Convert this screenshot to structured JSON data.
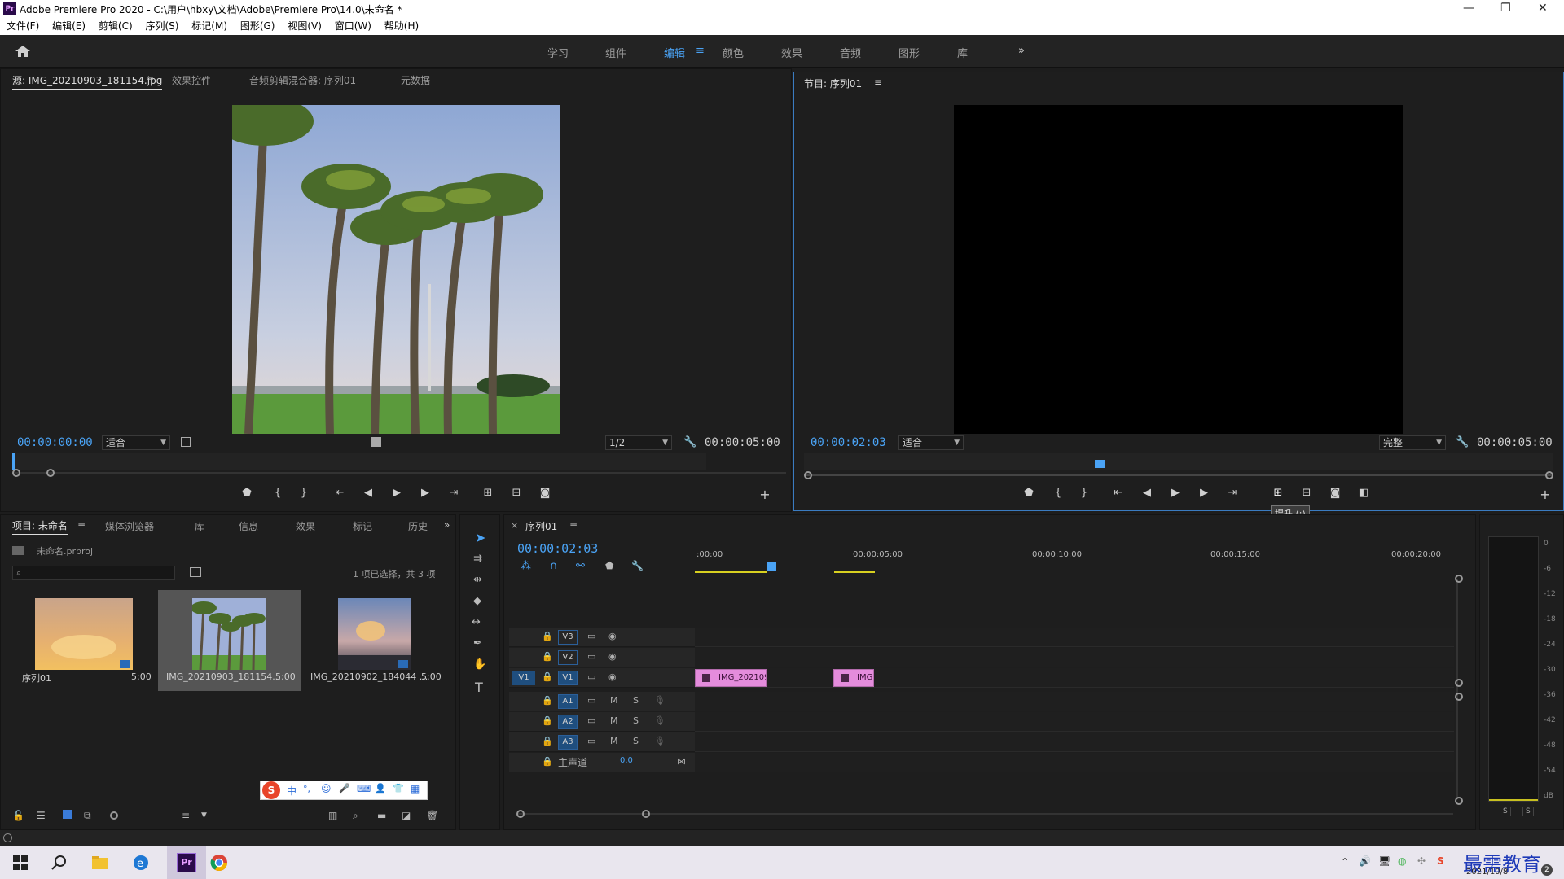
{
  "titlebar": {
    "app_icon": "Pr",
    "title": "Adobe Premiere Pro 2020 - C:\\用户\\hbxy\\文档\\Adobe\\Premiere Pro\\14.0\\未命名 *",
    "minimize": "—",
    "restore": "❐",
    "close": "✕"
  },
  "menubar": {
    "items": [
      "文件(F)",
      "编辑(E)",
      "剪辑(C)",
      "序列(S)",
      "标记(M)",
      "图形(G)",
      "视图(V)",
      "窗口(W)",
      "帮助(H)"
    ]
  },
  "workspaces": {
    "items": [
      "学习",
      "组件",
      "编辑",
      "颜色",
      "效果",
      "音频",
      "图形",
      "库"
    ],
    "active": "编辑",
    "menu_icon": "≡",
    "more": "»"
  },
  "source_panel": {
    "tabs": [
      "源: IMG_20210903_181154.jpg",
      "效果控件",
      "音频剪辑混合器: 序列01",
      "元数据"
    ],
    "tab_menu": "≡",
    "timecode": "00:00:00:00",
    "fit": "适合",
    "resolution": "1/2",
    "duration": "00:00:05:00"
  },
  "program_panel": {
    "tab": "节目: 序列01",
    "tab_menu": "≡",
    "timecode": "00:00:02:03",
    "fit": "适合",
    "quality": "完整",
    "duration": "00:00:05:00",
    "tooltip": "提升 (;)"
  },
  "project_panel": {
    "tabs": [
      "项目: 未命名",
      "媒体浏览器",
      "库",
      "信息",
      "效果",
      "标记",
      "历史"
    ],
    "tab_menu": "≡",
    "more": "»",
    "file": "未命名.prproj",
    "search_placeholder": "",
    "status": "1 项已选择，共 3 项",
    "items": [
      {
        "name": "序列01",
        "duration": "5:00"
      },
      {
        "name": "IMG_20210903_181154...",
        "duration": "5:00"
      },
      {
        "name": "IMG_20210902_184044 ...",
        "duration": "5:00"
      }
    ]
  },
  "ime_toolbar": {
    "logo": "S",
    "items": [
      "中",
      "°,",
      "☺",
      "🎤",
      "⌨",
      "👤",
      "👕",
      "▦"
    ]
  },
  "timeline": {
    "tab_close": "×",
    "tab": "序列01",
    "tab_menu": "≡",
    "timecode": "00:00:02:03",
    "ruler_labels": [
      ":00:00",
      "00:00:05:00",
      "00:00:10:00",
      "00:00:15:00",
      "00:00:20:00"
    ],
    "video_tracks": [
      {
        "name": "V3",
        "source": ""
      },
      {
        "name": "V2",
        "source": ""
      },
      {
        "name": "V1",
        "source": "V1"
      }
    ],
    "audio_tracks": [
      {
        "name": "A1",
        "source": "A1"
      },
      {
        "name": "A2",
        "source": "A2"
      },
      {
        "name": "A3",
        "source": "A3"
      }
    ],
    "mute_label": "M",
    "solo_label": "S",
    "master_label": "主声道",
    "master_value": "0.0",
    "clips": [
      {
        "label": "IMG_202109"
      },
      {
        "label": "IMG"
      }
    ]
  },
  "audio_meter": {
    "scale": [
      "0",
      "-6",
      "-12",
      "-18",
      "-24",
      "-30",
      "-36",
      "-42",
      "-48",
      "-54",
      "dB"
    ],
    "solo_left": "S",
    "solo_right": "S"
  },
  "taskbar": {
    "date": "2021/10/8",
    "watermark": "最需教育",
    "notify_count": "2"
  },
  "colors": {
    "accent": "#4aa3f5",
    "clip": "#e48cdc",
    "panel_bg": "#1e1e1e"
  }
}
